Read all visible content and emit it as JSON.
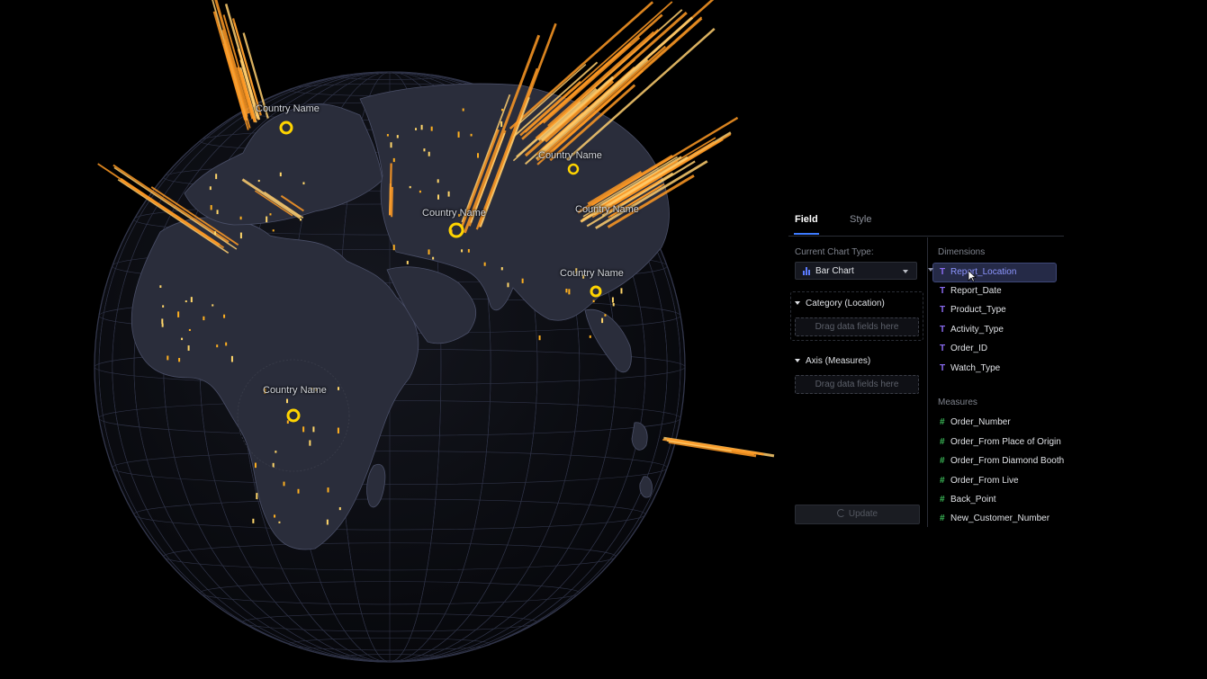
{
  "globe": {
    "country_labels": [
      "Country Name",
      "Country Name",
      "Country Name",
      "Country Name",
      "Country Name",
      "Country Name"
    ],
    "colors": {
      "background": "#000000",
      "land": "#2b2e3d",
      "grid": "#3a3e55",
      "bar_hot": "#ffd27a",
      "bar_base": "#ff8c1a",
      "marker": "#ffd400"
    }
  },
  "panel": {
    "tabs": [
      {
        "label": "Field",
        "active": true
      },
      {
        "label": "Style",
        "active": false
      }
    ],
    "current_chart_type_label": "Current Chart Type:",
    "chart_type_value": "Bar Chart",
    "category_section": "Category (Location)",
    "axis_section": "Axis (Measures)",
    "drop_placeholder": "Drag data fields here",
    "update_label": "Update",
    "dimensions_label": "Dimensions",
    "dimensions": [
      "Report_Location",
      "Report_Date",
      "Product_Type",
      "Activity_Type",
      "Order_ID",
      "Watch_Type"
    ],
    "measures_label": "Measures",
    "measures": [
      "Order_Number",
      "Order_From Place of Origin",
      "Order_From Diamond Booth",
      "Order_From Live",
      "Back_Point",
      "New_Customer_Number"
    ],
    "accent": "#3d7bff",
    "selected_color": "#8d96ff"
  }
}
